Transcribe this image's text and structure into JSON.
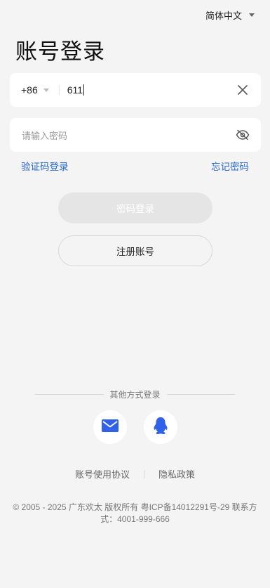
{
  "language": {
    "label": "简体中文"
  },
  "title": "账号登录",
  "phone": {
    "country_code": "+86",
    "value": "611"
  },
  "password": {
    "placeholder": "请输入密码"
  },
  "links": {
    "sms_login": "验证码登录",
    "forgot_password": "忘记密码"
  },
  "buttons": {
    "login": "密码登录",
    "register": "注册账号"
  },
  "other_login": {
    "label": "其他方式登录"
  },
  "footer": {
    "agreement": "账号使用协议",
    "privacy": "隐私政策",
    "copyright": "© 2005 - 2025 广东欢太 版权所有 粤ICP备14012291号-29   联系方式：4001-999-666"
  },
  "colors": {
    "link": "#2767d8",
    "background": "#f4f4f4",
    "disabled_button": "#e5e5e5"
  }
}
